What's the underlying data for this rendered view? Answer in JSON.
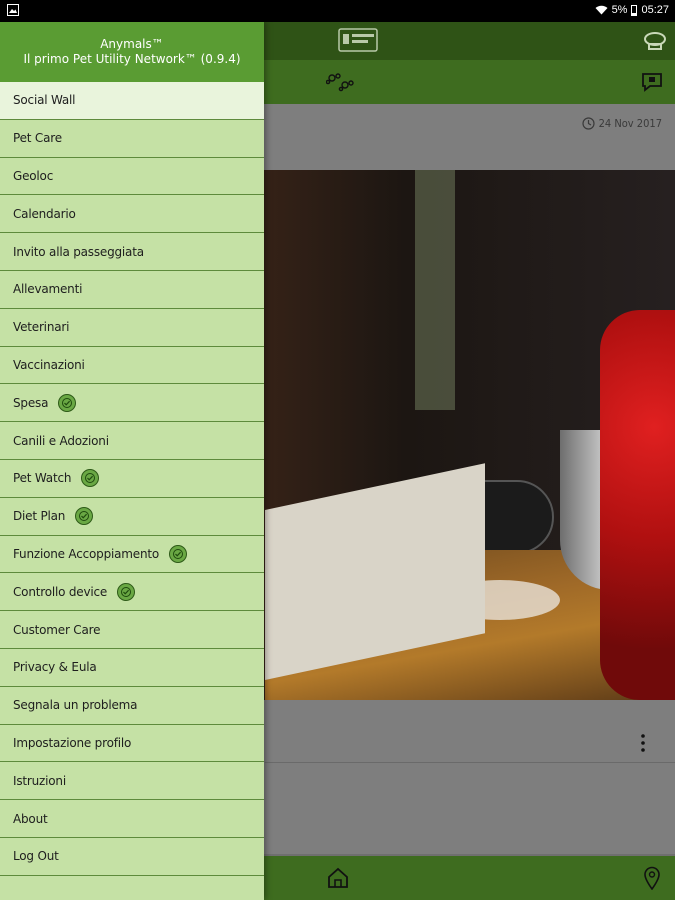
{
  "status_bar": {
    "battery": "5%",
    "time": "05:27",
    "left_icon": "gallery-notification-icon",
    "wifi_icon": "wifi-icon",
    "battery_icon": "battery-icon"
  },
  "background_app": {
    "date": "24 Nov 2017",
    "toolbar_icons": [
      "report-icon",
      "notification-icon"
    ],
    "subbar_icons": [
      "paw-prints-icon",
      "chat-icon"
    ],
    "bottom_icons": [
      "home-icon",
      "location-pin-icon"
    ],
    "colors": {
      "toolbar": "#2f5316",
      "subbar": "#3e6c1f"
    }
  },
  "drawer": {
    "title": "Anymals™",
    "subtitle": "Il primo Pet Utility Network™ (0.9.4)",
    "colors": {
      "header": "#5a9c33",
      "background": "#c5e1a5",
      "active": "#e9f4dc"
    },
    "items": [
      {
        "label": "Social Wall",
        "active": true,
        "badge": false
      },
      {
        "label": "Pet Care",
        "active": false,
        "badge": false
      },
      {
        "label": "Geoloc",
        "active": false,
        "badge": false
      },
      {
        "label": "Calendario",
        "active": false,
        "badge": false
      },
      {
        "label": "Invito alla passeggiata",
        "active": false,
        "badge": false
      },
      {
        "label": "Allevamenti",
        "active": false,
        "badge": false
      },
      {
        "label": "Veterinari",
        "active": false,
        "badge": false
      },
      {
        "label": "Vaccinazioni",
        "active": false,
        "badge": false
      },
      {
        "label": "Spesa",
        "active": false,
        "badge": true
      },
      {
        "label": "Canili e Adozioni",
        "active": false,
        "badge": false
      },
      {
        "label": "Pet Watch",
        "active": false,
        "badge": true
      },
      {
        "label": "Diet Plan",
        "active": false,
        "badge": true
      },
      {
        "label": "Funzione Accoppiamento",
        "active": false,
        "badge": true
      },
      {
        "label": "Controllo device",
        "active": false,
        "badge": true
      },
      {
        "label": "Customer Care",
        "active": false,
        "badge": false
      },
      {
        "label": "Privacy & Eula",
        "active": false,
        "badge": false
      },
      {
        "label": "Segnala un problema",
        "active": false,
        "badge": false
      },
      {
        "label": "Impostazione profilo",
        "active": false,
        "badge": false
      },
      {
        "label": "Istruzioni",
        "active": false,
        "badge": false
      },
      {
        "label": "About",
        "active": false,
        "badge": false
      },
      {
        "label": "Log Out",
        "active": false,
        "badge": false
      }
    ]
  }
}
